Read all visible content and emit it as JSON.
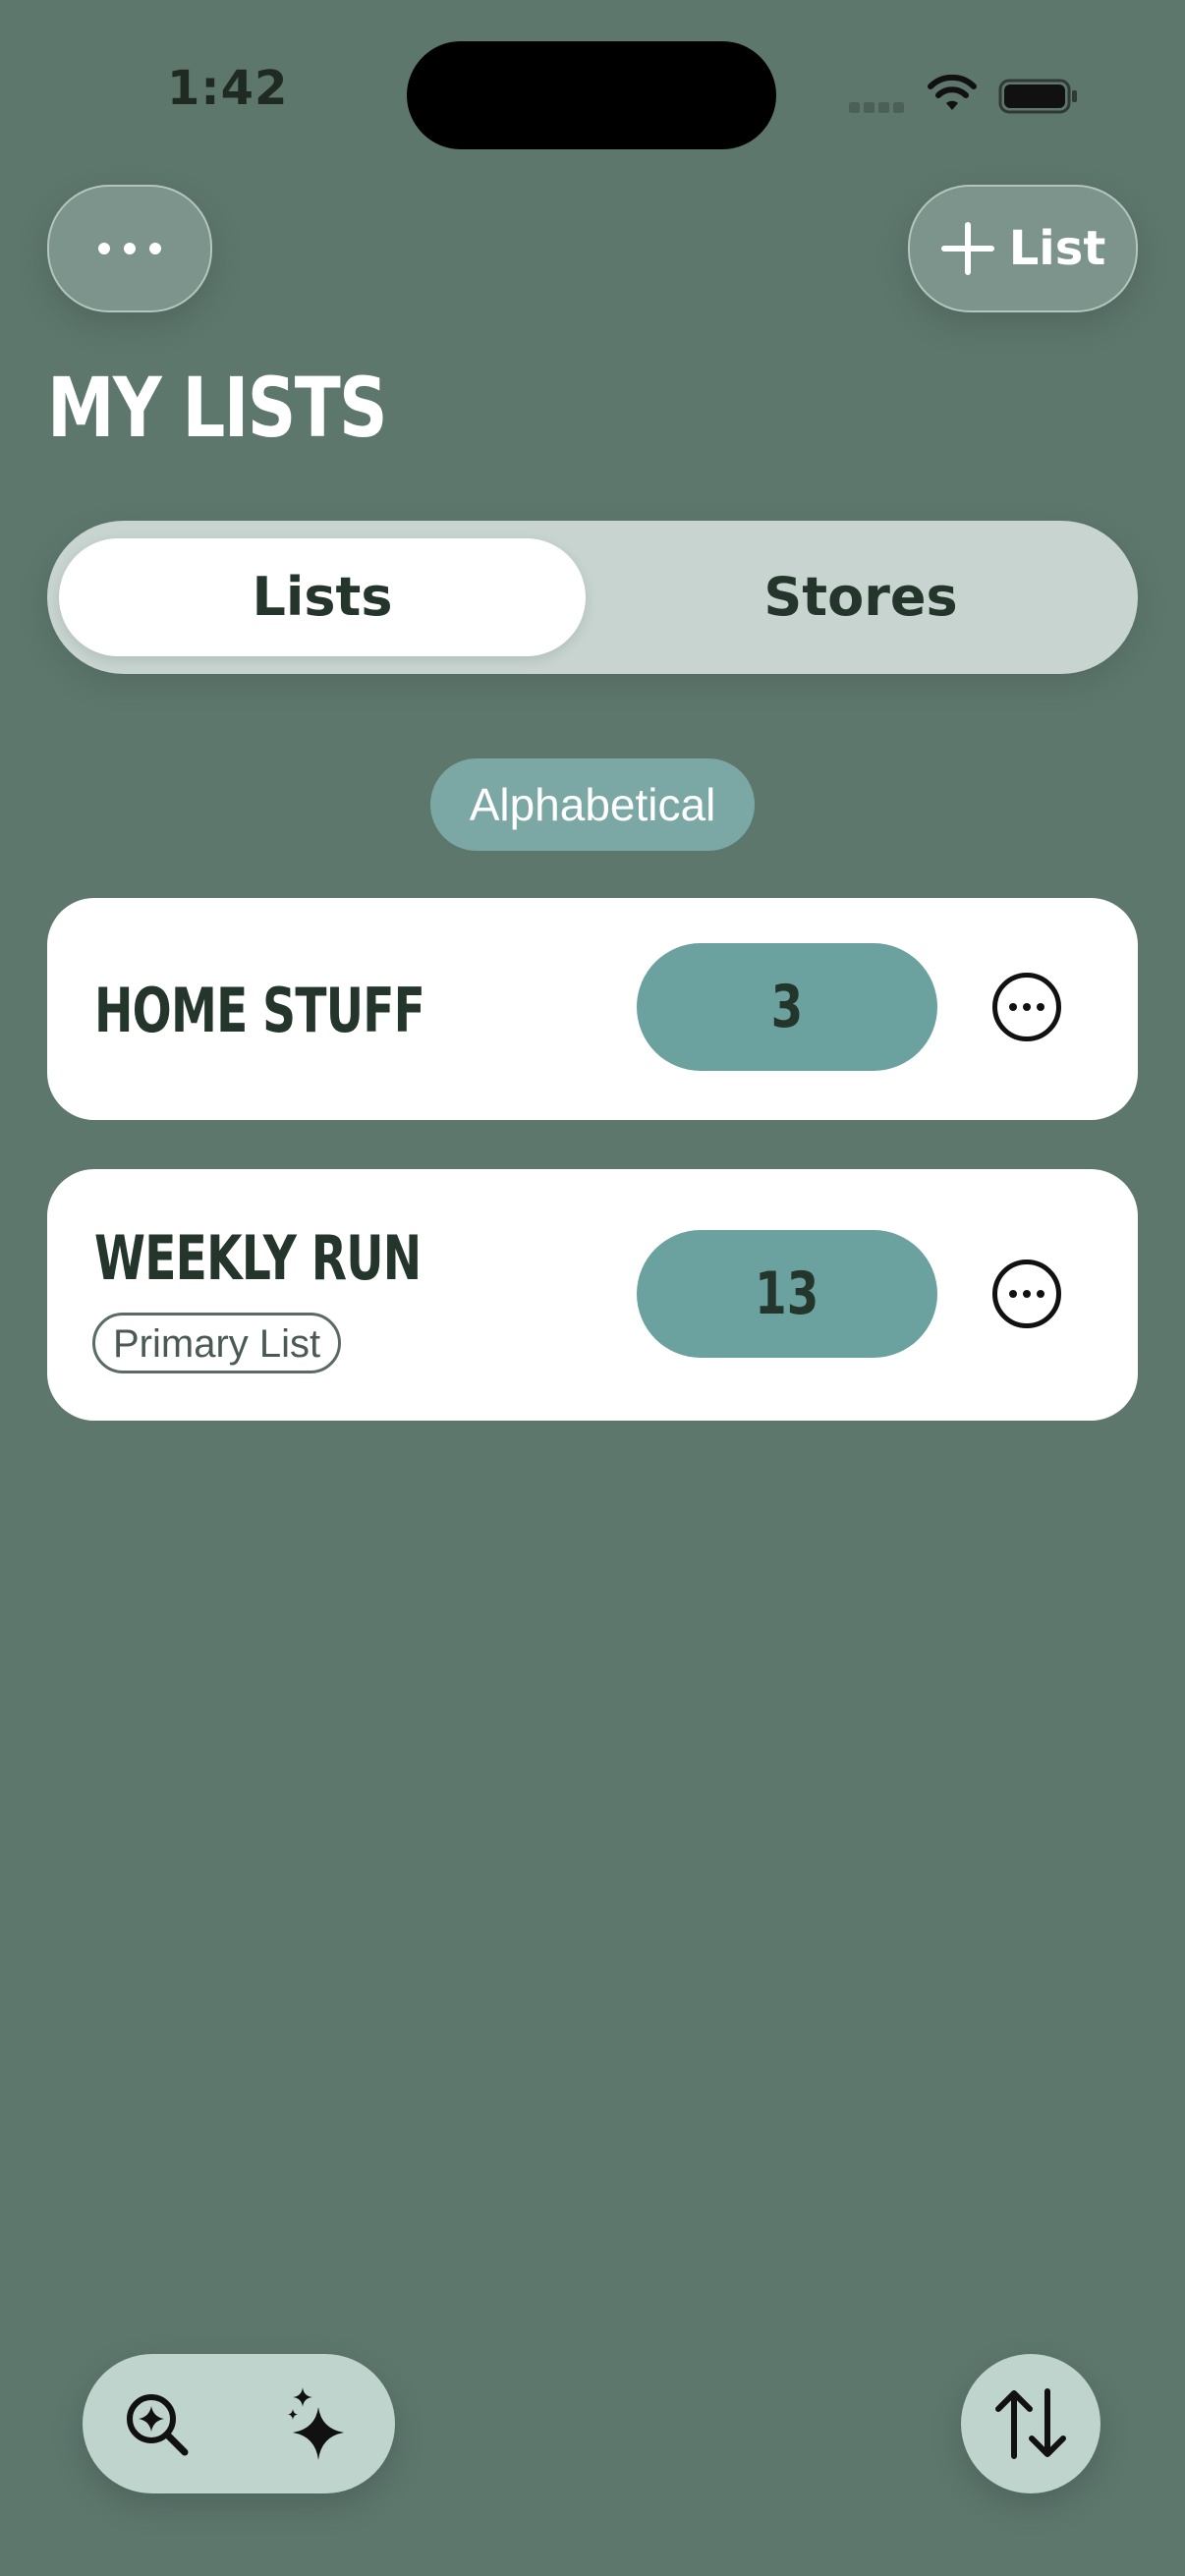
{
  "status_bar": {
    "time": "1:42"
  },
  "header": {
    "more_icon": "ellipsis-icon",
    "add_button": {
      "icon": "plus-icon",
      "label": "List"
    },
    "title": "MY LISTS"
  },
  "segmented": {
    "tabs": [
      {
        "label": "Lists",
        "selected": true
      },
      {
        "label": "Stores",
        "selected": false
      }
    ]
  },
  "sort": {
    "label": "Alphabetical"
  },
  "lists": [
    {
      "name": "HOME STUFF",
      "count": "3",
      "badge": ""
    },
    {
      "name": "WEEKLY RUN",
      "count": "13",
      "badge": "Primary List"
    }
  ],
  "bottom_bar": {
    "search_icon": "search-sparkle-icon",
    "ai_icon": "sparkles-icon",
    "sort_icon": "swap-vertical-icon"
  },
  "colors": {
    "background": "#5E776D",
    "accent": "#6BA2A0",
    "text_dark": "#24352C",
    "segment_track": "#C7D4CF",
    "bottom_pill": "#BFD4CD"
  }
}
